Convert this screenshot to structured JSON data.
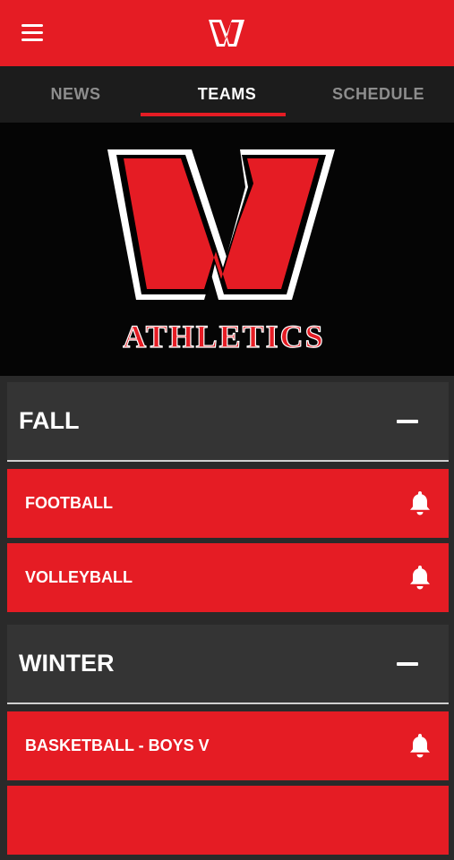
{
  "header": {
    "menu_icon": "hamburger-menu-icon",
    "logo_text": "W"
  },
  "tabs": [
    {
      "label": "NEWS",
      "active": false
    },
    {
      "label": "TEAMS",
      "active": true
    },
    {
      "label": "SCHEDULE",
      "active": false
    }
  ],
  "hero": {
    "logo_letter": "W",
    "logo_text": "ATHLETICS"
  },
  "sections": [
    {
      "title": "FALL",
      "teams": [
        "FOOTBALL",
        "VOLLEYBALL"
      ]
    },
    {
      "title": "WINTER",
      "teams": [
        "BASKETBALL - BOYS V"
      ]
    }
  ],
  "colors": {
    "brand_red": "#e51c24",
    "tab_bar": "#1c1c1c",
    "section_bg": "#343434",
    "page_bg": "#2a2a2a"
  }
}
